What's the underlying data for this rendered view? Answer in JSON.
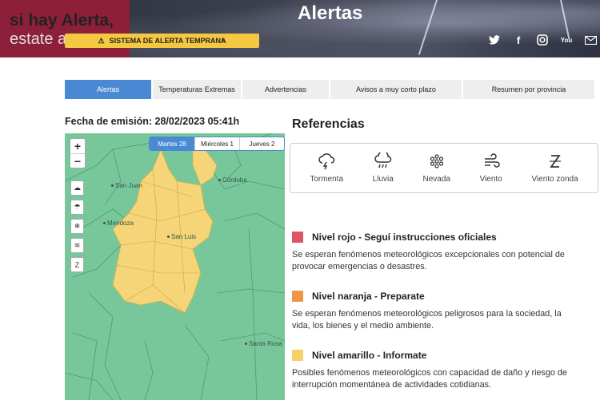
{
  "header": {
    "title": "Alertas",
    "promo_line1": "si hay Alerta,",
    "promo_line2": "estate a",
    "sat_button": "SISTEMA DE ALERTA TEMPRANA",
    "social_icons": [
      "twitter-icon",
      "facebook-icon",
      "instagram-icon",
      "youtube-icon",
      "mail-icon"
    ]
  },
  "tabs": [
    {
      "label": "Alertas",
      "active": true
    },
    {
      "label": "Temperaturas Extremas",
      "active": false
    },
    {
      "label": "Advertencias",
      "active": false
    },
    {
      "label": "Avisos a muy corto plazo",
      "active": false
    },
    {
      "label": "Resumen por provincia",
      "active": false
    }
  ],
  "emision": "Fecha de emisión: 28/02/2023 05:41h",
  "map": {
    "zoom_in": "+",
    "zoom_out": "−",
    "days": [
      "Martes 28",
      "Miércoles 1",
      "Jueves 2"
    ],
    "selected_day": "Martes 28",
    "cities": [
      "San Juan",
      "Córdoba",
      "Mendoza",
      "San Luis",
      "Santa Rosa"
    ],
    "colors": {
      "green": "#78c79a",
      "yellow": "#f5d578",
      "border": "#4f9a70"
    }
  },
  "referencias": {
    "title": "Referencias",
    "items": [
      {
        "label": "Tormenta",
        "icon": "storm-icon"
      },
      {
        "label": "Lluvia",
        "icon": "rain-icon"
      },
      {
        "label": "Nevada",
        "icon": "snowflake-icon"
      },
      {
        "label": "Viento",
        "icon": "wind-icon"
      },
      {
        "label": "Viento zonda",
        "icon": "zonda-icon"
      }
    ]
  },
  "levels": [
    {
      "title": "Nivel rojo - Seguí instrucciones oficiales",
      "color": "#e05563",
      "desc": "Se esperan fenómenos meteorológicos excepcionales con potencial de provocar emergencias o desastres."
    },
    {
      "title": "Nivel naranja - Preparate",
      "color": "#f0964a",
      "desc": "Se esperan fenómenos meteorológicos peligrosos para la sociedad, la vida, los bienes y el medio ambiente."
    },
    {
      "title": "Nivel amarillo - Informate",
      "color": "#f6d06a",
      "desc": "Posibles fenómenos meteorológicos con capacidad de daño y riesgo de interrupción momentánea de actividades cotidianas."
    }
  ]
}
